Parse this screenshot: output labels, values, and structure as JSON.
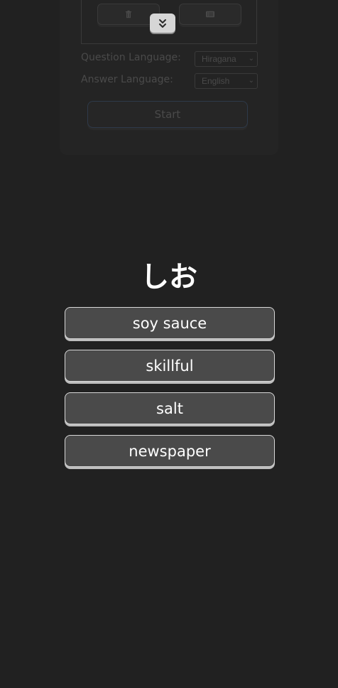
{
  "settings": {
    "question_language_label": "Question Language:",
    "question_language_value": "Hiragana",
    "answer_language_label": "Answer Language:",
    "answer_language_value": "English",
    "start_label": "Start",
    "icons": {
      "delete": "trash-icon",
      "list": "list-icon",
      "collapse": "double-chevron-down-icon"
    }
  },
  "quiz": {
    "question": "しお",
    "answers": [
      "soy sauce",
      "skillful",
      "salt",
      "newspaper"
    ]
  },
  "colors": {
    "background": "#212121",
    "answer_button": "#4a4a4a",
    "answer_border": "#d8d8d8",
    "text": "#ffffff"
  }
}
